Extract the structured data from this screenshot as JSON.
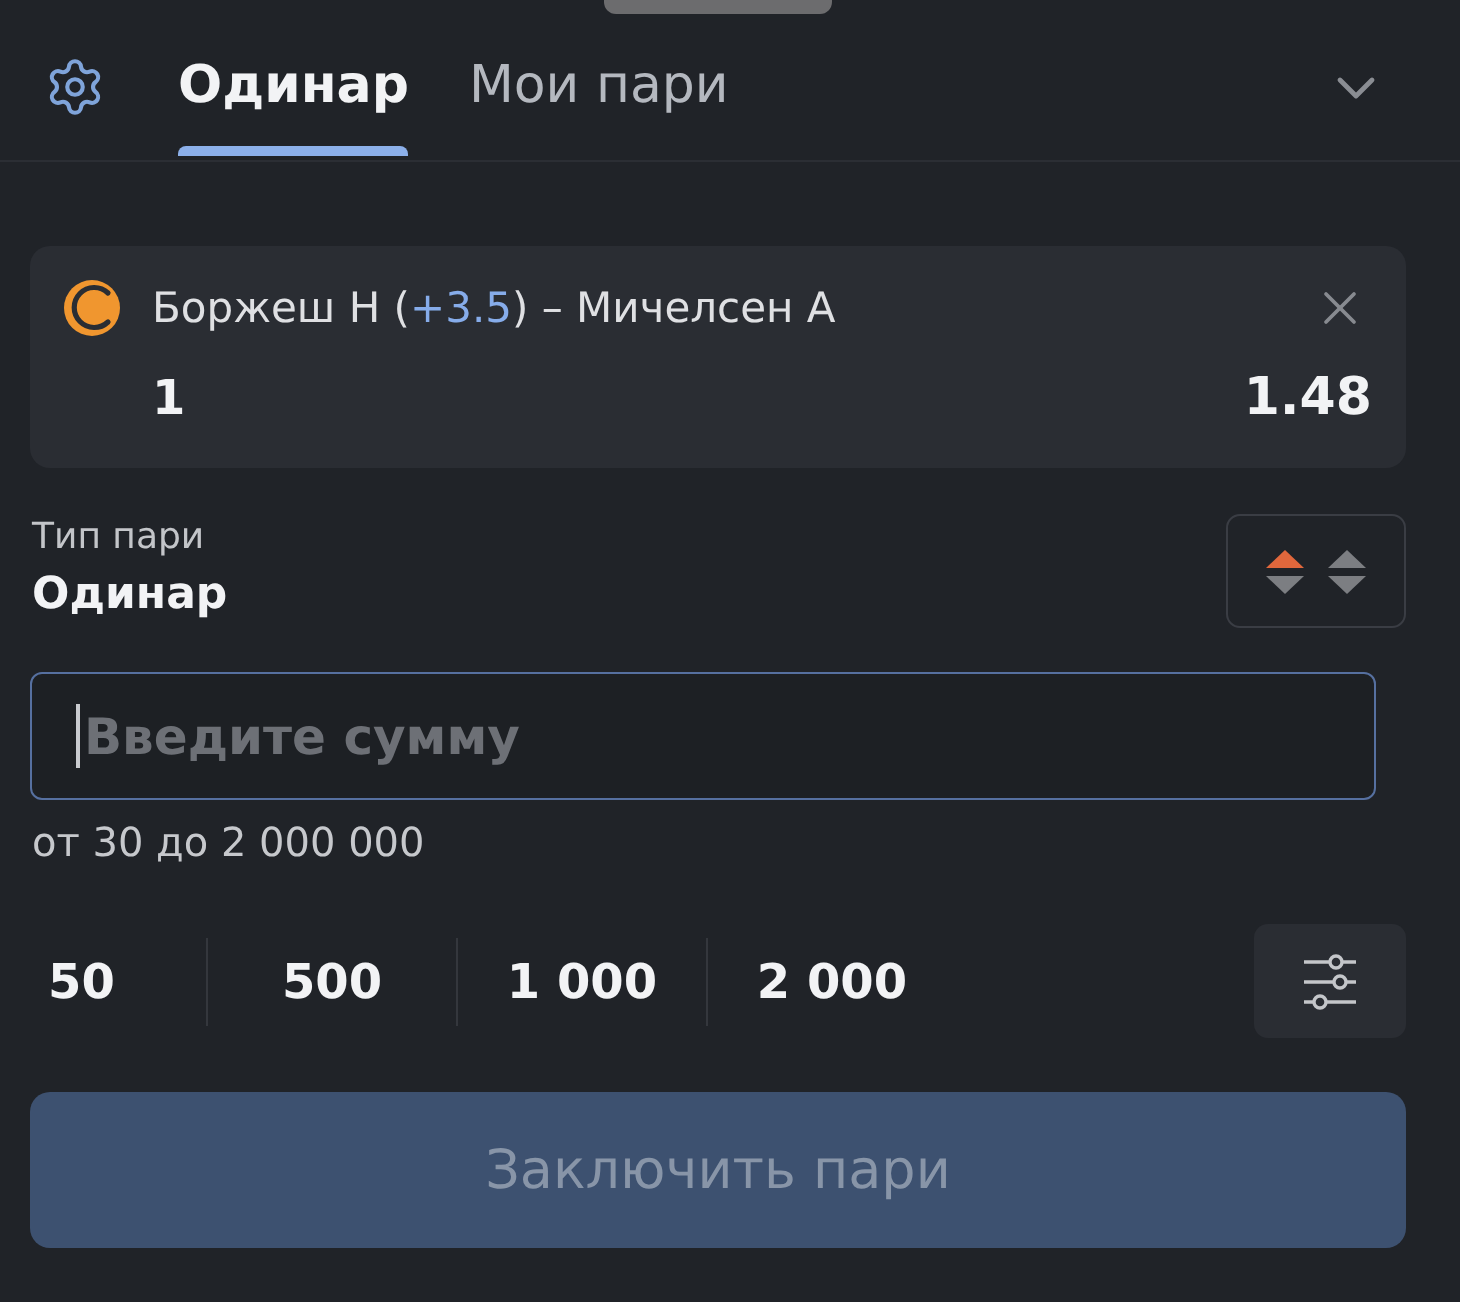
{
  "tabs": [
    {
      "label": "Одинар",
      "selected": true
    },
    {
      "label": "Мои пари",
      "selected": false
    }
  ],
  "bet": {
    "selection": [
      {
        "text": "Боржеш Н (",
        "highlight": false
      },
      {
        "text": "+3.5",
        "highlight": true
      },
      {
        "text": ") – Мичелсен А",
        "highlight": false
      }
    ],
    "outcome": "1",
    "odds": "1.48"
  },
  "bet_type": {
    "label": "Тип пари",
    "value": "Одинар"
  },
  "amount": {
    "placeholder": "Введите сумму",
    "focused": true,
    "limits": "от 30 до 2 000 000"
  },
  "quick_amounts": [
    "50",
    "500",
    "1 000",
    "2 000"
  ],
  "submit": {
    "label": "Заключить пари",
    "disabled": true
  }
}
